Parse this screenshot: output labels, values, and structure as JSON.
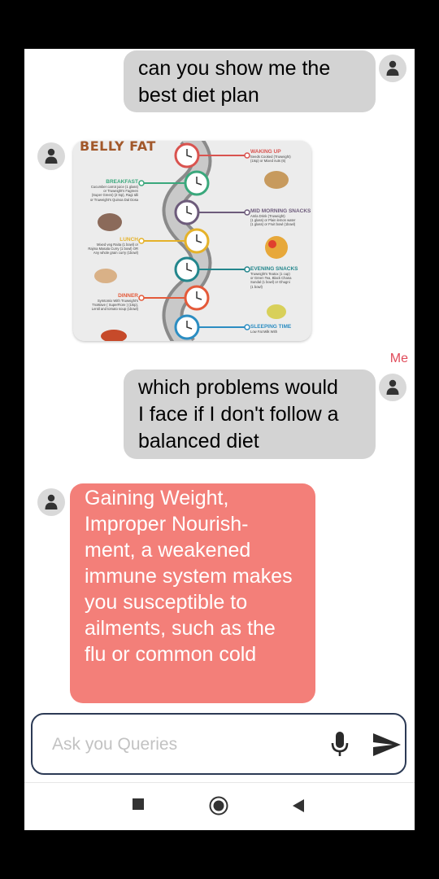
{
  "chat": {
    "msg1": "can you show me the\nbest diet plan",
    "infographic": {
      "title": "BELLY FAT",
      "items": [
        {
          "heading": "WAKING UP",
          "text": "Seeds Cooked (Truweight)\n(1tsp) or Mixed nuts (6)",
          "color": "#d9534f"
        },
        {
          "heading": "BREAKFAST",
          "text": "Cucumber carrot juice (1 glass)\nor Truweight's Fagreen\n(Super Green) (2 tsp), Ragi Idli\nor Truweight's Quinoa Dal Dosa",
          "color": "#3aa87c"
        },
        {
          "heading": "MID MORNING SNACKS",
          "text": "Amla Drink (Truweight)\n(1 glass) or Plain lemon water\n(1 glass) or Fruit bowl (1bowl)",
          "color": "#6d5b7b"
        },
        {
          "heading": "LUNCH",
          "text": "Mixed veg Raita (1 bowl) or\nRajma Masala Curry (1 bowl) OR\nAny whole grain curry (1bowl)",
          "color": "#e5b22a"
        },
        {
          "heading": "EVENING SNACKS",
          "text": "Truweight's Teatox (1 cup)\nor Green Tea, Black Chana\nSundal (1 bowl) or Ghugni\n(1 bowl)",
          "color": "#23868c"
        },
        {
          "heading": "DINNER",
          "text": "Symtomix With Truweight's\nTruWave ( SuperFiore ) (1tsp),\nLentil and tomato soup (1bowl)",
          "color": "#e45a3a"
        },
        {
          "heading": "SLEEPING TIME",
          "text": "Low Fat Milk With",
          "color": "#2b8dc2"
        }
      ]
    },
    "me_label": "Me",
    "msg2": "which problems would\nI face if I don't follow a\nbalanced diet",
    "reply": "Gaining Weight,\nImproper Nourish-\nment,  a weakened\nimmune system makes\nyou susceptible to\nailments, such as the\nflu or common cold"
  },
  "input": {
    "placeholder": "Ask you Queries",
    "value": ""
  },
  "icons": {
    "avatar": "person-icon",
    "mic": "mic-icon",
    "send": "send-icon",
    "nav": [
      "square-stop-icon",
      "home-circle-icon",
      "back-triangle-icon"
    ]
  },
  "colors": {
    "bubble_out": "#d3d3d3",
    "bubble_in": "#f37f79",
    "accent": "#e04b5a",
    "input_border": "#2c3a55"
  }
}
